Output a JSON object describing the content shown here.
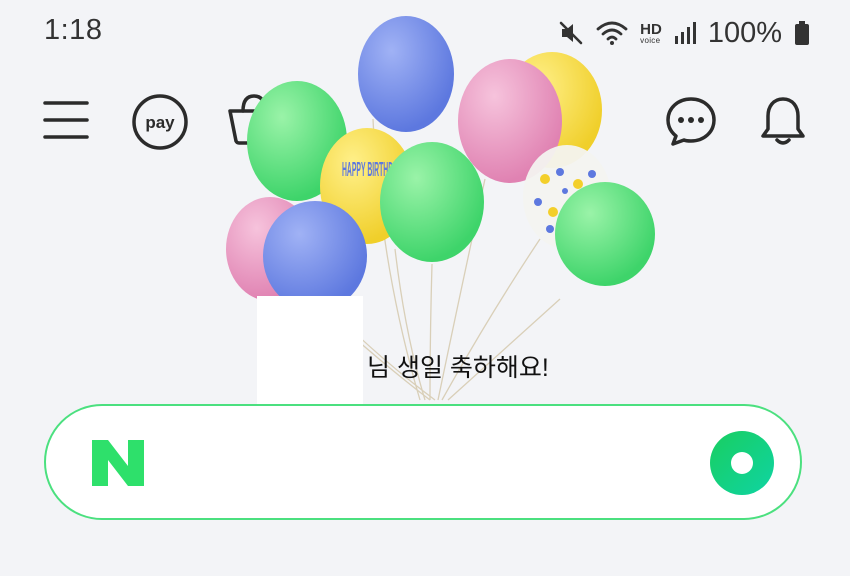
{
  "status_bar": {
    "time": "1:18",
    "hd_label": "HD",
    "voice_label": "voice",
    "battery": "100%",
    "icons": [
      "mute-icon",
      "wifi-icon",
      "signal-icon",
      "battery-icon"
    ]
  },
  "header": {
    "pay_label": "pay",
    "icons": [
      "menu-icon",
      "pay-icon",
      "shopping-bag-icon",
      "chat-icon",
      "bell-icon"
    ]
  },
  "banner": {
    "balloon_text": "HAPPY BIRTHDAY",
    "birthday_message": "님 생일 축하해요!"
  },
  "search": {
    "logo": "N",
    "icons": [
      "naver-logo",
      "green-dot-icon"
    ],
    "colors": {
      "border": "#4be07f",
      "logo": "#2ee06b",
      "dot": "#19ce60"
    }
  }
}
